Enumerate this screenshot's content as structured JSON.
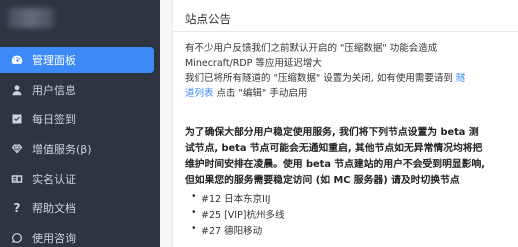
{
  "sidebar": {
    "items": [
      {
        "label": "管理面板",
        "icon": "dashboard-icon",
        "active": true
      },
      {
        "label": "用户信息",
        "icon": "user-icon",
        "active": false
      },
      {
        "label": "每日签到",
        "icon": "checkbox-icon",
        "active": false
      },
      {
        "label": "增值服务(β)",
        "icon": "diamond-icon",
        "active": false
      },
      {
        "label": "实名认证",
        "icon": "id-card-icon",
        "active": false
      },
      {
        "label": "帮助文档",
        "icon": "question-icon",
        "active": false
      },
      {
        "label": "使用咨询",
        "icon": "chat-icon",
        "active": false
      }
    ],
    "active_color": "#3d8af7",
    "bg_color": "#2e3440"
  },
  "notice": {
    "title": "站点公告",
    "line1": "有不少用户反馈我们之前默认开启的 \"压缩数据\" 功能会造成",
    "line2": "Minecraft/RDP 等应用延迟增大",
    "line3_pre": "我们已将所有隧道的 \"压缩数据\" 设置为关闭, 如有使用需要请到 ",
    "line3_link": "隧",
    "line4_link": "道列表",
    "line4_post": " 点击 \"编辑\" 手动启用",
    "bold1": "为了确保大部分用户稳定使用服务, 我们将下列节点设置为 beta 测",
    "bold2": "试节点, beta 节点可能会无通知重启, 其他节点如无异常情况均将把",
    "bold3": "维护时间安排在凌晨。使用 beta 节点建站的用户不会受到明显影响,",
    "bold4": "但如果您的服务需要稳定访问 (如 MC 服务器) 请及时切换节点",
    "nodes": [
      "#12 日本东京IIJ",
      "#25 [VIP]杭州多线",
      "#27 德阳移动"
    ]
  }
}
